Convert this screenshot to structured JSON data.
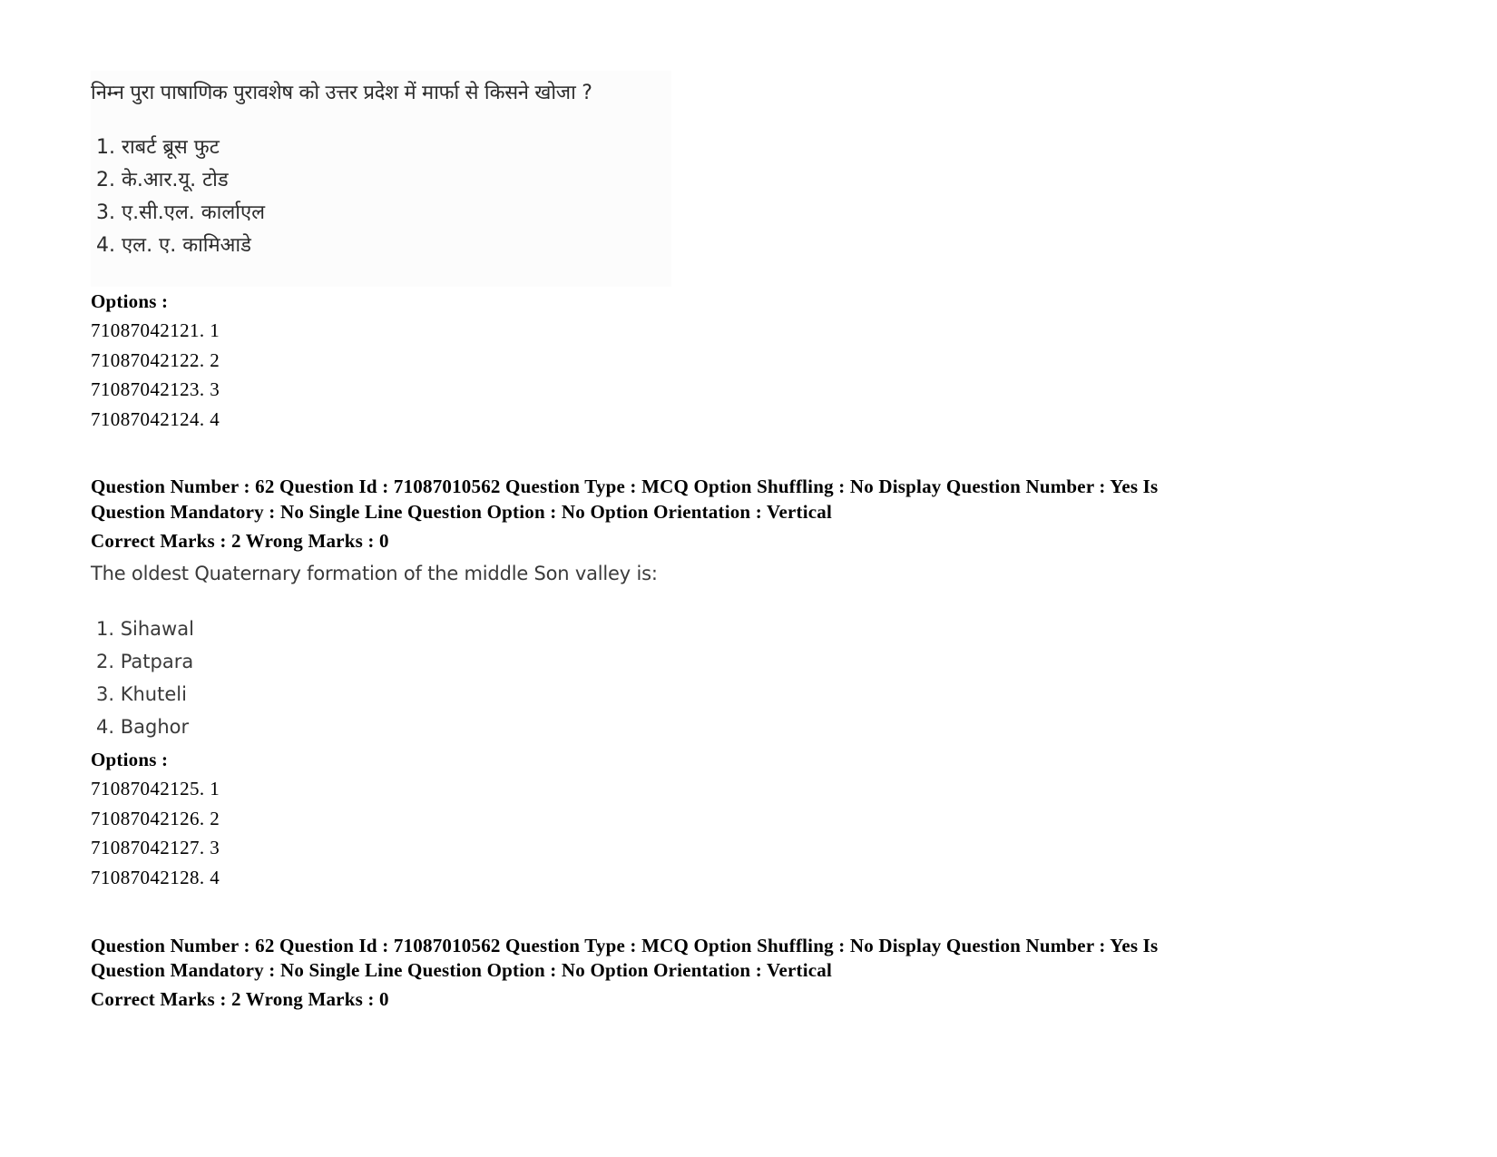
{
  "question_block_1": {
    "question_text": "निम्न पुरा पाषाणिक पुरावशेष को उत्तर प्रदेश में मार्फा से किसने खोजा ?",
    "choices": [
      "1. राबर्ट ब्रूस फुट",
      "2. के.आर.यू. टोड",
      "3. ए.सी.एल. कार्लाएल",
      "4. एल. ए. कामिआडे"
    ],
    "options_label": "Options :",
    "options": [
      "71087042121. 1",
      "71087042122. 2",
      "71087042123. 3",
      "71087042124. 4"
    ]
  },
  "question_block_2": {
    "meta_line_1": "Question Number : 62 Question Id : 71087010562 Question Type : MCQ Option Shuffling : No Display Question Number : Yes Is",
    "meta_line_2": "Question Mandatory : No Single Line Question Option : No Option Orientation : Vertical",
    "marks_line": "Correct Marks : 2 Wrong Marks : 0",
    "question_text": "The oldest Quaternary formation of the middle Son valley is:",
    "choices": [
      "1. Sihawal",
      "2. Patpara",
      "3. Khuteli",
      "4. Baghor"
    ],
    "options_label": "Options :",
    "options": [
      "71087042125. 1",
      "71087042126. 2",
      "71087042127. 3",
      "71087042128. 4"
    ]
  },
  "question_block_3": {
    "meta_line_1": "Question Number : 62 Question Id : 71087010562 Question Type : MCQ Option Shuffling : No Display Question Number : Yes Is",
    "meta_line_2": "Question Mandatory : No Single Line Question Option : No Option Orientation : Vertical",
    "marks_line": "Correct Marks : 2 Wrong Marks : 0"
  }
}
